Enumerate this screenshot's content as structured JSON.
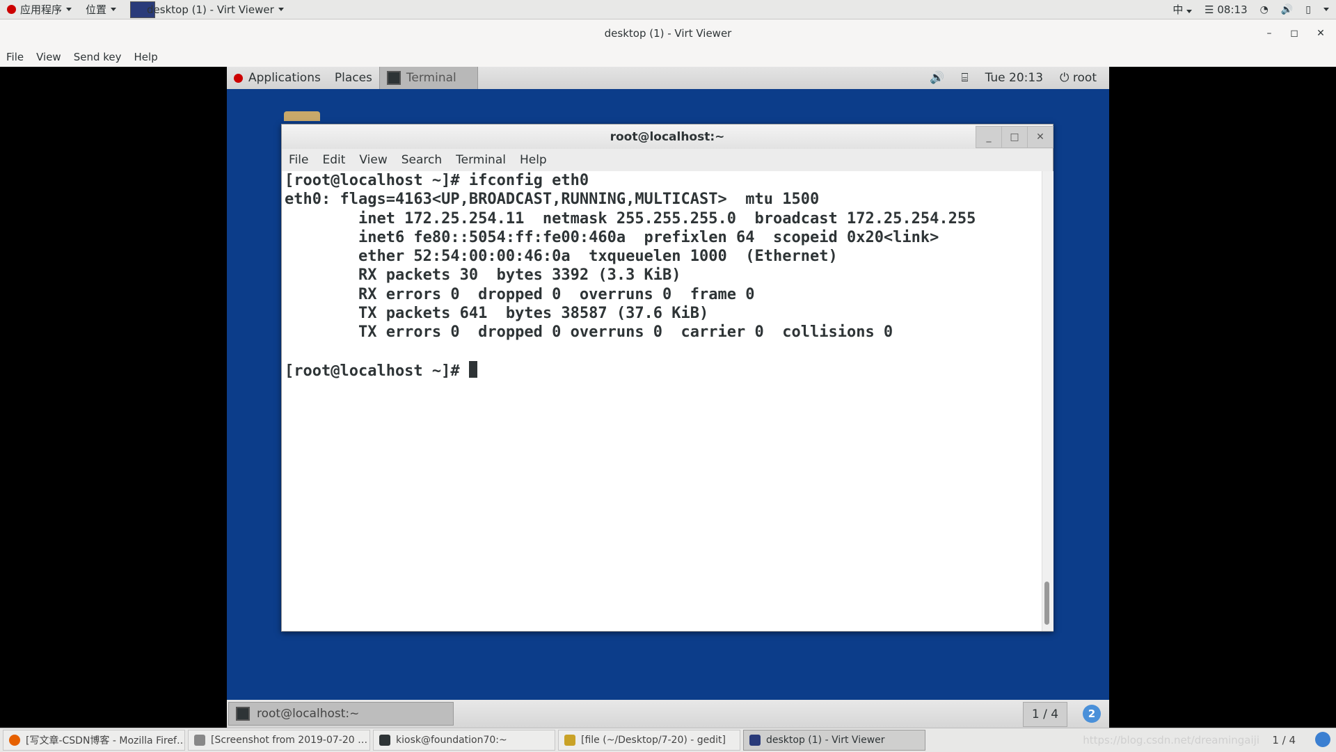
{
  "host_top": {
    "applications": "应用程序",
    "places": "位置",
    "active_window": "desktop (1) - Virt Viewer",
    "input_method": "中",
    "clock": "08:13",
    "menu_glyph": "☰"
  },
  "viewer": {
    "title": "desktop (1) - Virt Viewer",
    "minimize": "–",
    "maximize": "◻",
    "close": "✕",
    "menu": [
      "File",
      "View",
      "Send key",
      "Help"
    ]
  },
  "guest": {
    "top_panel": {
      "applications": "Applications",
      "places": "Places",
      "terminal": "Terminal",
      "clock": "Tue 20:13",
      "user": "root"
    },
    "terminal": {
      "title": "root@localhost:~",
      "minimize": "_",
      "maximize": "□",
      "close": "✕",
      "menu": [
        "File",
        "Edit",
        "View",
        "Search",
        "Terminal",
        "Help"
      ],
      "output": "[root@localhost ~]# ifconfig eth0\neth0: flags=4163<UP,BROADCAST,RUNNING,MULTICAST>  mtu 1500\n        inet 172.25.254.11  netmask 255.255.255.0  broadcast 172.25.254.255\n        inet6 fe80::5054:ff:fe00:460a  prefixlen 64  scopeid 0x20<link>\n        ether 52:54:00:00:46:0a  txqueuelen 1000  (Ethernet)\n        RX packets 30  bytes 3392 (3.3 KiB)\n        RX errors 0  dropped 0  overruns 0  frame 0\n        TX packets 641  bytes 38587 (37.6 KiB)\n        TX errors 0  dropped 0 overruns 0  carrier 0  collisions 0\n\n[root@localhost ~]# "
    },
    "bottom_panel": {
      "task": "root@localhost:~",
      "workspace": "1 / 4",
      "badge": "2"
    }
  },
  "host_bottom": {
    "tasks": [
      {
        "label": "[写文章-CSDN博客 - Mozilla Firef…",
        "color": "#e66000"
      },
      {
        "label": "[Screenshot from 2019-07-20 …",
        "color": "#888888"
      },
      {
        "label": "kiosk@foundation70:~",
        "color": "#2e3436"
      },
      {
        "label": "[file (~/Desktop/7-20) - gedit]",
        "color": "#c9a227"
      },
      {
        "label": "desktop (1) - Virt Viewer",
        "color": "#2a3b7a"
      }
    ],
    "workspace": "1 / 4",
    "watermark": "https://blog.csdn.net/dreamingaiji"
  }
}
